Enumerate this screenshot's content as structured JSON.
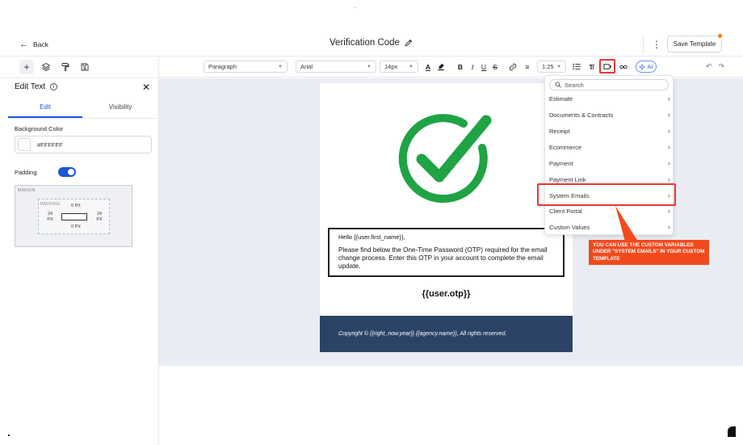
{
  "header": {
    "back_label": "Back",
    "title": "Verification Code",
    "save_label": "Save Template",
    "kebab": "⋮"
  },
  "toolbar": {
    "block_type": "Paragraph",
    "font_family": "Arial",
    "font_size": "14px",
    "line_height": "1.25",
    "ai_label": "AI"
  },
  "icons": {
    "add": "+",
    "layers": "layers-icon",
    "paint": "paint-roller-icon",
    "save": "floppy-icon",
    "text_color": "A",
    "bold": "B",
    "italic": "I",
    "underline": "U",
    "strikethrough": "S",
    "link": "⛓",
    "align": "≡",
    "list": "☰",
    "clear_format": "T̸",
    "merge_field": "merge-field-icon",
    "unlink": "unlink-icon"
  },
  "panel": {
    "title": "Edit Text",
    "tabs": [
      "Edit",
      "Visibility"
    ],
    "bg_color_label": "Background Color",
    "bg_color_value": "#FFFFFF",
    "padding_label": "Padding",
    "padding_enabled": true,
    "margin_label": "MARGIN",
    "padding_box_label": "PADDING",
    "padding_top": "0 PX",
    "padding_bottom": "0 PX",
    "padding_left": "24",
    "padding_left_unit": "PX",
    "padding_right": "24",
    "padding_right_unit": "PX"
  },
  "email": {
    "greeting": "Hello {{user.first_name}},",
    "body": "Please find below the One-Time Password (OTP) required for the email change process. Enter this OTP in your account to complete the email update.",
    "otp": "{{user.otp}}",
    "footer": "Copyright © {{right_now.year}}  {{agency.name}}, All rights reserved."
  },
  "dropdown": {
    "search_placeholder": "Search",
    "items": [
      "Estimate",
      "Documents & Contracts",
      "Receipt",
      "Ecommerce",
      "Payment",
      "Payment Link",
      "System Emails",
      "Client Portal",
      "Custom Values"
    ]
  },
  "callout": {
    "text": "YOU CAN USE THE CUSTOM VARIABLES UNDER \"SYSTEM EMAILS\" IN YOUR CUSTOM TEMPLATE"
  },
  "colors": {
    "accent_blue": "#1a56db",
    "highlight_red": "#e53935",
    "callout_orange": "#f24a1d",
    "footer_navy": "#2c4366",
    "check_green": "#1fa344"
  }
}
